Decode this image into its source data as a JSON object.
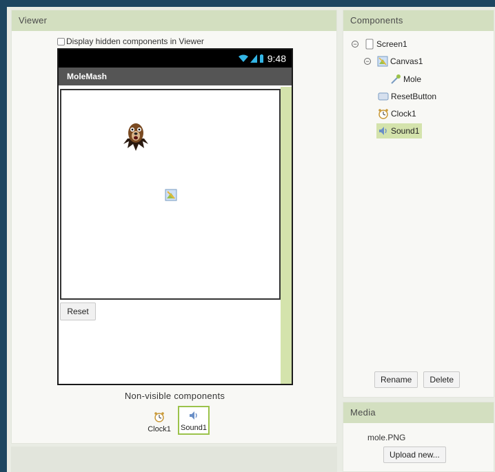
{
  "viewer": {
    "header": "Viewer",
    "hidden_toggle_label": "Display hidden components in Viewer",
    "phone": {
      "time": "9:48",
      "app_title": "MoleMash",
      "reset_label": "Reset"
    },
    "nonvisible_title": "Non-visible components",
    "nonvisible_items": [
      {
        "label": "Clock1",
        "icon": "clock-icon",
        "selected": false
      },
      {
        "label": "Sound1",
        "icon": "speaker-icon",
        "selected": true
      }
    ]
  },
  "components": {
    "header": "Components",
    "tree": [
      {
        "label": "Screen1",
        "icon": "screen-icon"
      },
      {
        "label": "Canvas1",
        "icon": "canvas-icon"
      },
      {
        "label": "Mole",
        "icon": "sprite-icon"
      },
      {
        "label": "ResetButton",
        "icon": "button-icon"
      },
      {
        "label": "Clock1",
        "icon": "clock-icon"
      },
      {
        "label": "Sound1",
        "icon": "speaker-icon",
        "selected": true
      }
    ],
    "rename_label": "Rename",
    "delete_label": "Delete"
  },
  "media": {
    "header": "Media",
    "file": "mole.PNG",
    "upload_label": "Upload new..."
  },
  "colors": {
    "header_bg": "#d3dfc0",
    "selection": "#d4e3ac",
    "selection_border": "#9bc24a",
    "outer_bg": "#1d4660"
  }
}
